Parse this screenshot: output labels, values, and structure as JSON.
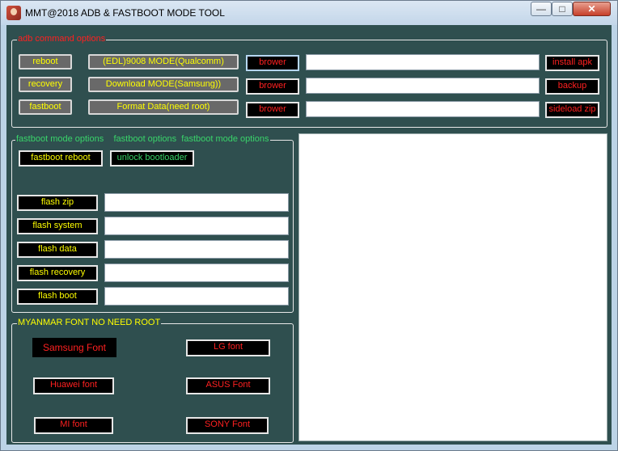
{
  "window": {
    "title": "MMT@2018 ADB & FASTBOOT MODE TOOL",
    "controls": {
      "minimize": "—",
      "maximize": "□",
      "close": "✕"
    }
  },
  "adb": {
    "legend": "adb command options",
    "reboot": "reboot",
    "recovery": "recovery",
    "fastboot": "fastboot",
    "edl": "(EDL)9008 MODE(Qualcomm)",
    "download": "Download  MODE(Samsung))",
    "format": "Format Data(need root)",
    "browse1": "brower",
    "browse2": "brower",
    "browse3": "brower",
    "path1": "",
    "path2": "",
    "path3": "",
    "install_apk": "install apk",
    "backup": "backup",
    "sideload": "sideload zip"
  },
  "fastboot": {
    "legend_1": "fastboot mode options",
    "legend_2": "fastboot options",
    "legend_3": "fastboot mode options",
    "reboot": "fastboot reboot",
    "unlock": "unlock bootloader",
    "flash_zip": "flash zip",
    "flash_system": "flash system",
    "flash_data": "flash data",
    "flash_recovery": "flash recovery",
    "flash_boot": "flash boot",
    "zip_path": "",
    "system_path": "",
    "data_path": "",
    "recovery_path": "",
    "boot_path": ""
  },
  "myanmar": {
    "legend": "MYANMAR FONT NO NEED ROOT",
    "samsung": "Samsung Font",
    "lg": "LG font",
    "huawei": "Huawei font",
    "asus": "ASUS Font",
    "mi": "MI font",
    "sony": "SONY Font"
  },
  "colors": {
    "background": "#2f4f4f",
    "accent_red": "#ff2020",
    "accent_yellow": "#ffff00",
    "accent_green": "#39d46a"
  }
}
